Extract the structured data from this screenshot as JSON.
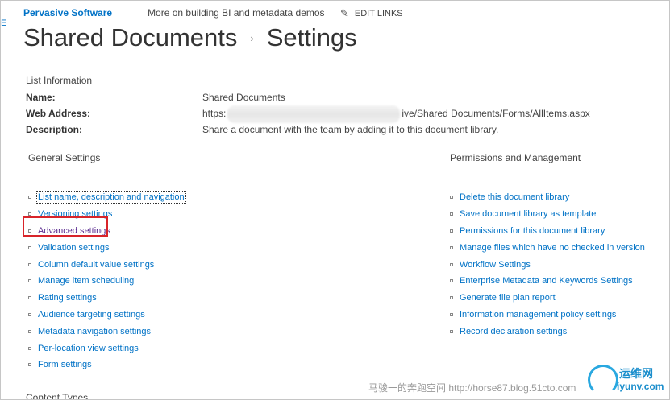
{
  "topnav": {
    "left_edge_mark": "E",
    "site_title": "Pervasive Software",
    "link": "More on building BI and metadata demos",
    "edit_links": "EDIT LINKS"
  },
  "page_title": {
    "library": "Shared Documents",
    "separator": "›",
    "page": "Settings"
  },
  "list_info": {
    "header": "List Information",
    "name_label": "Name:",
    "name_value": "Shared Documents",
    "web_address_label": "Web Address:",
    "web_address_prefix": "https:",
    "web_address_suffix": "ive/Shared Documents/Forms/AllItems.aspx",
    "description_label": "Description:",
    "description_value": "Share a document with the team by adding it to this document library."
  },
  "general_settings": {
    "header": "General Settings",
    "links": [
      "List name, description and navigation",
      "Versioning settings",
      "Advanced settings",
      "Validation settings",
      "Column default value settings",
      "Manage item scheduling",
      "Rating settings",
      "Audience targeting settings",
      "Metadata navigation settings",
      "Per-location view settings",
      "Form settings"
    ]
  },
  "permissions": {
    "header": "Permissions and Management",
    "links": [
      "Delete this document library",
      "Save document library as template",
      "Permissions for this document library",
      "Manage files which have no checked in version",
      "Workflow Settings",
      "Enterprise Metadata and Keywords Settings",
      "Generate file plan report",
      "Information management policy settings",
      "Record declaration settings"
    ]
  },
  "content_types": {
    "header": "Content Types"
  },
  "watermark": {
    "text": "马骏一的奔跑空间 http://horse87.blog.51cto.com",
    "logo_cn": "运维网",
    "logo_en": "iyunv.com"
  },
  "colors": {
    "link": "#0072c6",
    "visited": "#5c2d91",
    "highlight": "#d8242a"
  }
}
